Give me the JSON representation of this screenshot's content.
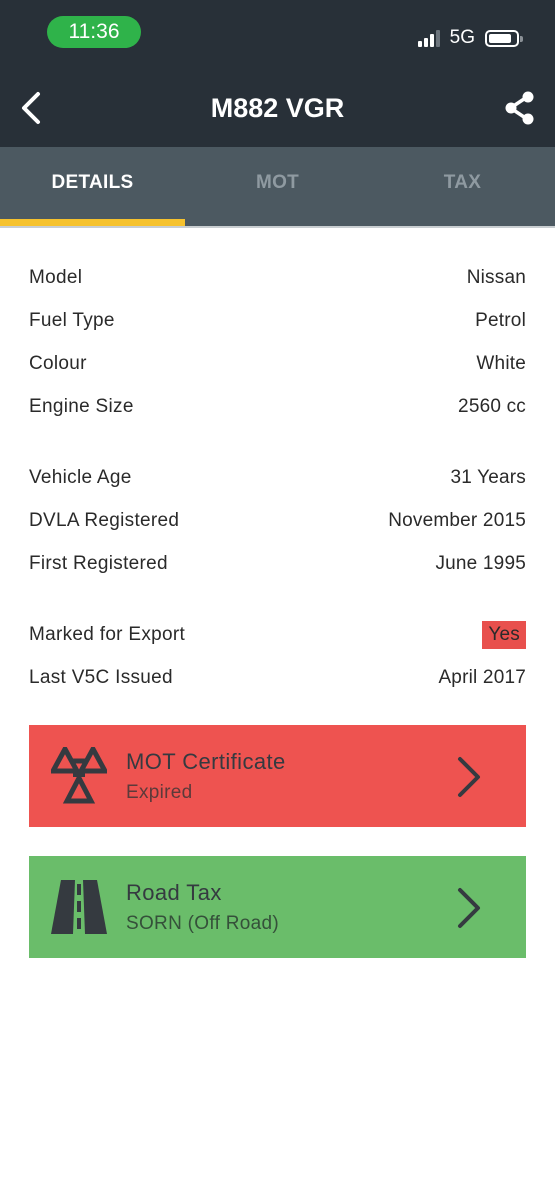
{
  "status_bar": {
    "time": "11:36",
    "network": "5G"
  },
  "header": {
    "title": "M882 VGR"
  },
  "tabs": [
    {
      "label": "DETAILS",
      "active": true
    },
    {
      "label": "MOT",
      "active": false
    },
    {
      "label": "TAX",
      "active": false
    }
  ],
  "details": {
    "groups": [
      [
        {
          "label": "Model",
          "value": "Nissan"
        },
        {
          "label": "Fuel Type",
          "value": "Petrol"
        },
        {
          "label": "Colour",
          "value": "White"
        },
        {
          "label": "Engine Size",
          "value": "2560 cc"
        }
      ],
      [
        {
          "label": "Vehicle Age",
          "value": "31 Years"
        },
        {
          "label": "DVLA Registered",
          "value": "November 2015"
        },
        {
          "label": "First Registered",
          "value": "June 1995"
        }
      ],
      [
        {
          "label": "Marked for Export",
          "value": "Yes"
        },
        {
          "label": "Last V5C Issued",
          "value": "April 2017"
        }
      ]
    ]
  },
  "cards": {
    "mot": {
      "title": "MOT Certificate",
      "status": "Expired",
      "color": "#ee5350",
      "icon": "mot-triangles-icon"
    },
    "tax": {
      "title": "Road Tax",
      "status": "SORN (Off Road)",
      "color": "#6abd6a",
      "icon": "road-icon"
    }
  },
  "colors": {
    "header_bg": "#283038",
    "tabs_bg": "#4c5961",
    "tab_indicator": "#f6c22e",
    "status_time_pill": "#2fb34a",
    "export_badge": "#e8504d"
  }
}
